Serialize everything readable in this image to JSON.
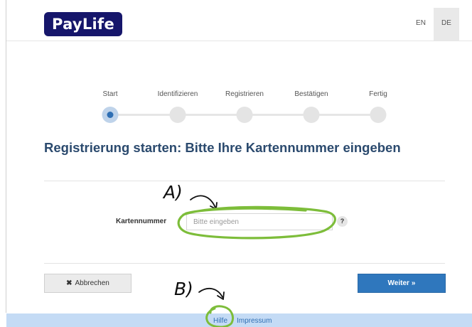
{
  "header": {
    "logo_text": "PayLife",
    "languages": [
      {
        "code": "EN",
        "active": false
      },
      {
        "code": "DE",
        "active": true
      }
    ]
  },
  "stepper": {
    "steps": [
      {
        "label": "Start",
        "active": true
      },
      {
        "label": "Identifizieren",
        "active": false
      },
      {
        "label": "Registrieren",
        "active": false
      },
      {
        "label": "Bestätigen",
        "active": false
      },
      {
        "label": "Fertig",
        "active": false
      }
    ]
  },
  "main": {
    "heading": "Registrierung starten: Bitte Ihre Kartennummer eingeben",
    "card_field": {
      "label": "Kartennummer",
      "value": "",
      "placeholder": "Bitte eingeben",
      "help_label": "?"
    }
  },
  "actions": {
    "cancel_label": "Abbrechen",
    "cancel_icon": "✖",
    "next_label": "Weiter",
    "next_icon": "»"
  },
  "footer": {
    "links": [
      "Hilfe",
      "Impressum"
    ]
  },
  "annotations": {
    "a_label": "A)",
    "b_label": "B)"
  },
  "colors": {
    "brand_navy": "#16166b",
    "accent_blue": "#2f77bd",
    "footer_bg": "#c4dbf5",
    "annotation_green": "#7dbd3a"
  }
}
